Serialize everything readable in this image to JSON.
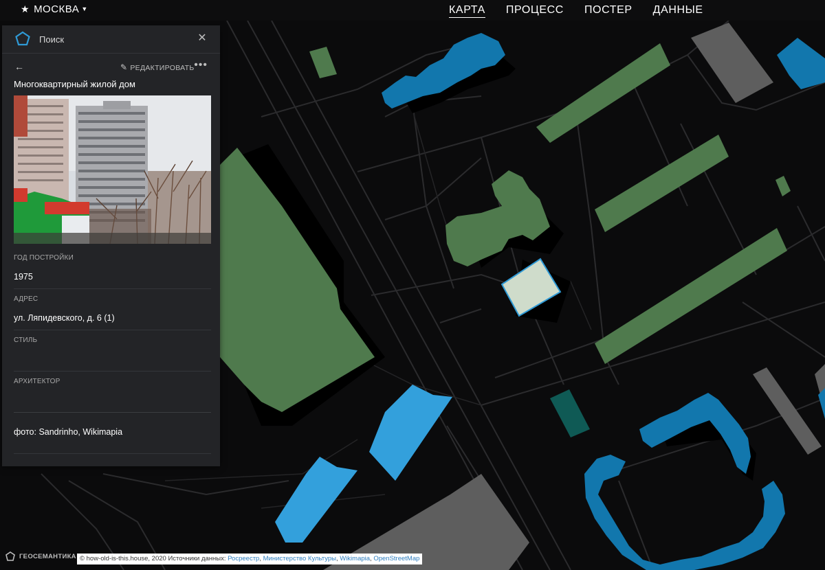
{
  "topbar": {
    "city": "МОСКВА",
    "nav": [
      "КАРТА",
      "ПРОЦЕСС",
      "ПОСТЕР",
      "ДАННЫЕ"
    ],
    "active_nav": "КАРТА"
  },
  "panel": {
    "search_label": "Поиск",
    "edit_label": "РЕДАКТИРОВАТЬ",
    "building_type": "Многоквартирный жилой дом",
    "fields": [
      {
        "label": "ГОД ПОСТРОЙКИ",
        "value": "1975"
      },
      {
        "label": "АДРЕС",
        "value": "ул. Ляпидевского, д. 6 (1)"
      },
      {
        "label": "СТИЛЬ",
        "value": ""
      },
      {
        "label": "АРХИТЕКТОР",
        "value": ""
      }
    ],
    "photo_credit": "фото: Sandrinho, Wikimapia"
  },
  "footer": {
    "brand": "ГЕОСЕМАНТИКА",
    "copyright": "© how-old-is-this.house, 2020 Источники данных:",
    "sources": [
      "Росреестр",
      "Министерство Культуры",
      "Wikimapia",
      "OpenStreetMap"
    ]
  },
  "colors": {
    "background": "#0b0b0c",
    "panel": "#232427",
    "green_building": "#4f7a4d",
    "blue_building": "#1277ad",
    "light_blue_building": "#33a0dc",
    "gray_building": "#5e5e5e",
    "teal_building": "#0f5a55",
    "selected_building": "#cfdccb",
    "accent": "#2f9ad6"
  }
}
